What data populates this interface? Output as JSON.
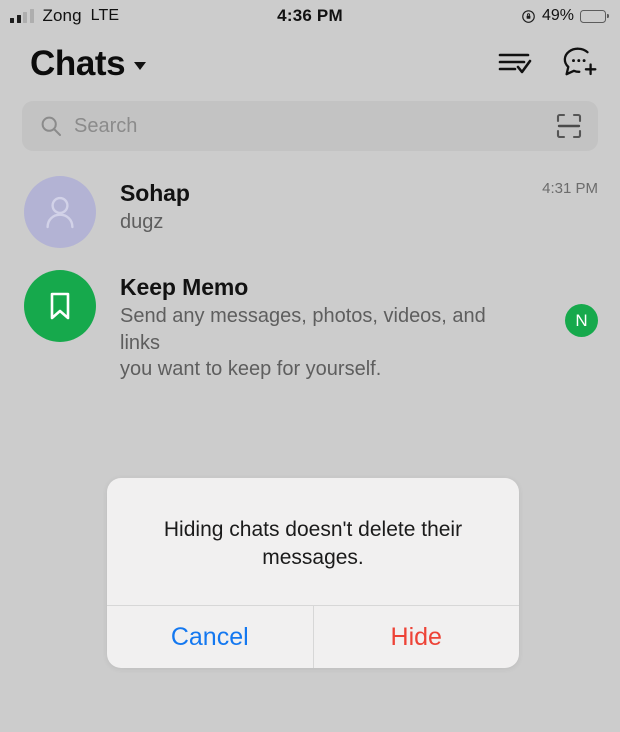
{
  "status_bar": {
    "carrier": "Zong",
    "network": "LTE",
    "time": "4:36 PM",
    "battery_percent": "49%",
    "battery_level": 49,
    "signal_bars_filled": 2,
    "signal_bars_total": 4,
    "rotation_lock_icon": "rotation-lock-icon",
    "battery_icon": "battery-icon"
  },
  "header": {
    "title": "Chats",
    "dropdown_icon": "chevron-down-icon",
    "select_icon": "list-check-icon",
    "new_chat_icon": "new-chat-bubble-icon"
  },
  "search": {
    "placeholder": "Search",
    "value": "",
    "search_icon": "search-icon",
    "scan_icon": "scan-qr-icon"
  },
  "chats": [
    {
      "name": "Sohap",
      "preview": "dugz",
      "time": "4:31 PM",
      "avatar_icon": "person-avatar-icon",
      "avatar_color": "#b3b3d4",
      "badge": ""
    },
    {
      "name": "Keep Memo",
      "preview": "Send any messages, photos, videos, and links\nyou want to keep for yourself.",
      "time": "",
      "avatar_icon": "bookmark-icon",
      "avatar_color": "#16a94c",
      "badge": "N",
      "badge_color": "#16a94c"
    }
  ],
  "alert": {
    "message": "Hiding chats doesn't delete their messages.",
    "cancel_label": "Cancel",
    "confirm_label": "Hide",
    "cancel_color": "#1478f0",
    "confirm_color": "#ed4337"
  },
  "colors": {
    "background": "#cccccc",
    "search_field": "#c3c3c3",
    "accent_green": "#16a94c"
  }
}
